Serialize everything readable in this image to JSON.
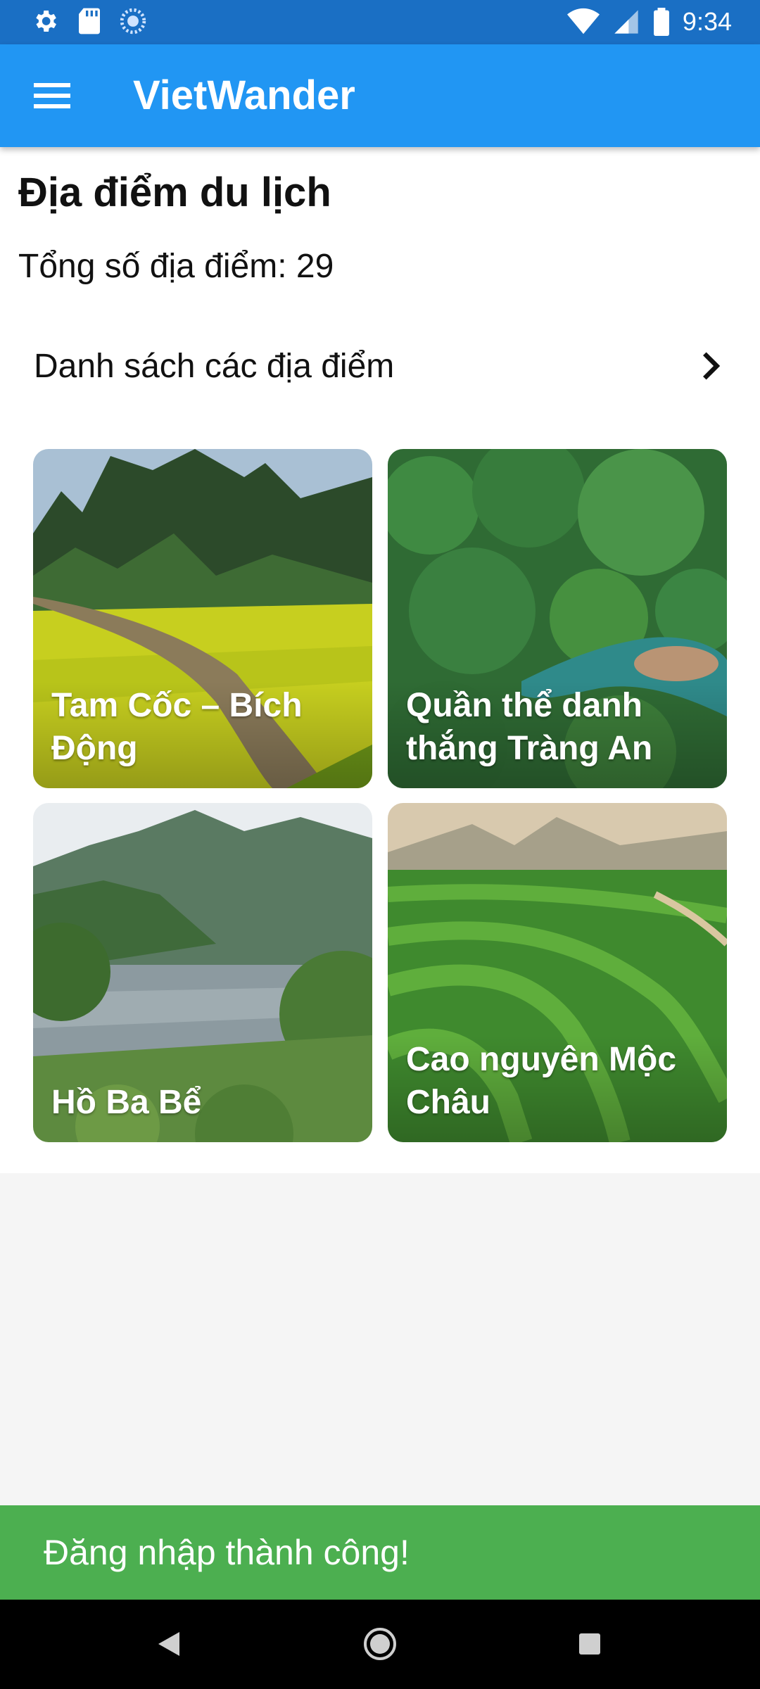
{
  "status_bar": {
    "time": "9:34"
  },
  "app_bar": {
    "title": "VietWander"
  },
  "page": {
    "title": "Địa điểm du lịch",
    "count_label": "Tổng số địa điểm: 29"
  },
  "section": {
    "label": "Danh sách các địa điểm"
  },
  "cards": [
    {
      "title": "Tam Cốc – Bích Động"
    },
    {
      "title": "Quần thể danh thắng Tràng An"
    },
    {
      "title": "Hồ Ba Bể"
    },
    {
      "title": "Cao nguyên Mộc Châu"
    }
  ],
  "snackbar": {
    "message": "Đăng nhập thành công!"
  },
  "colors": {
    "status_bar": "#1a6fc4",
    "app_bar": "#2196f3",
    "snackbar": "#4caf50"
  }
}
